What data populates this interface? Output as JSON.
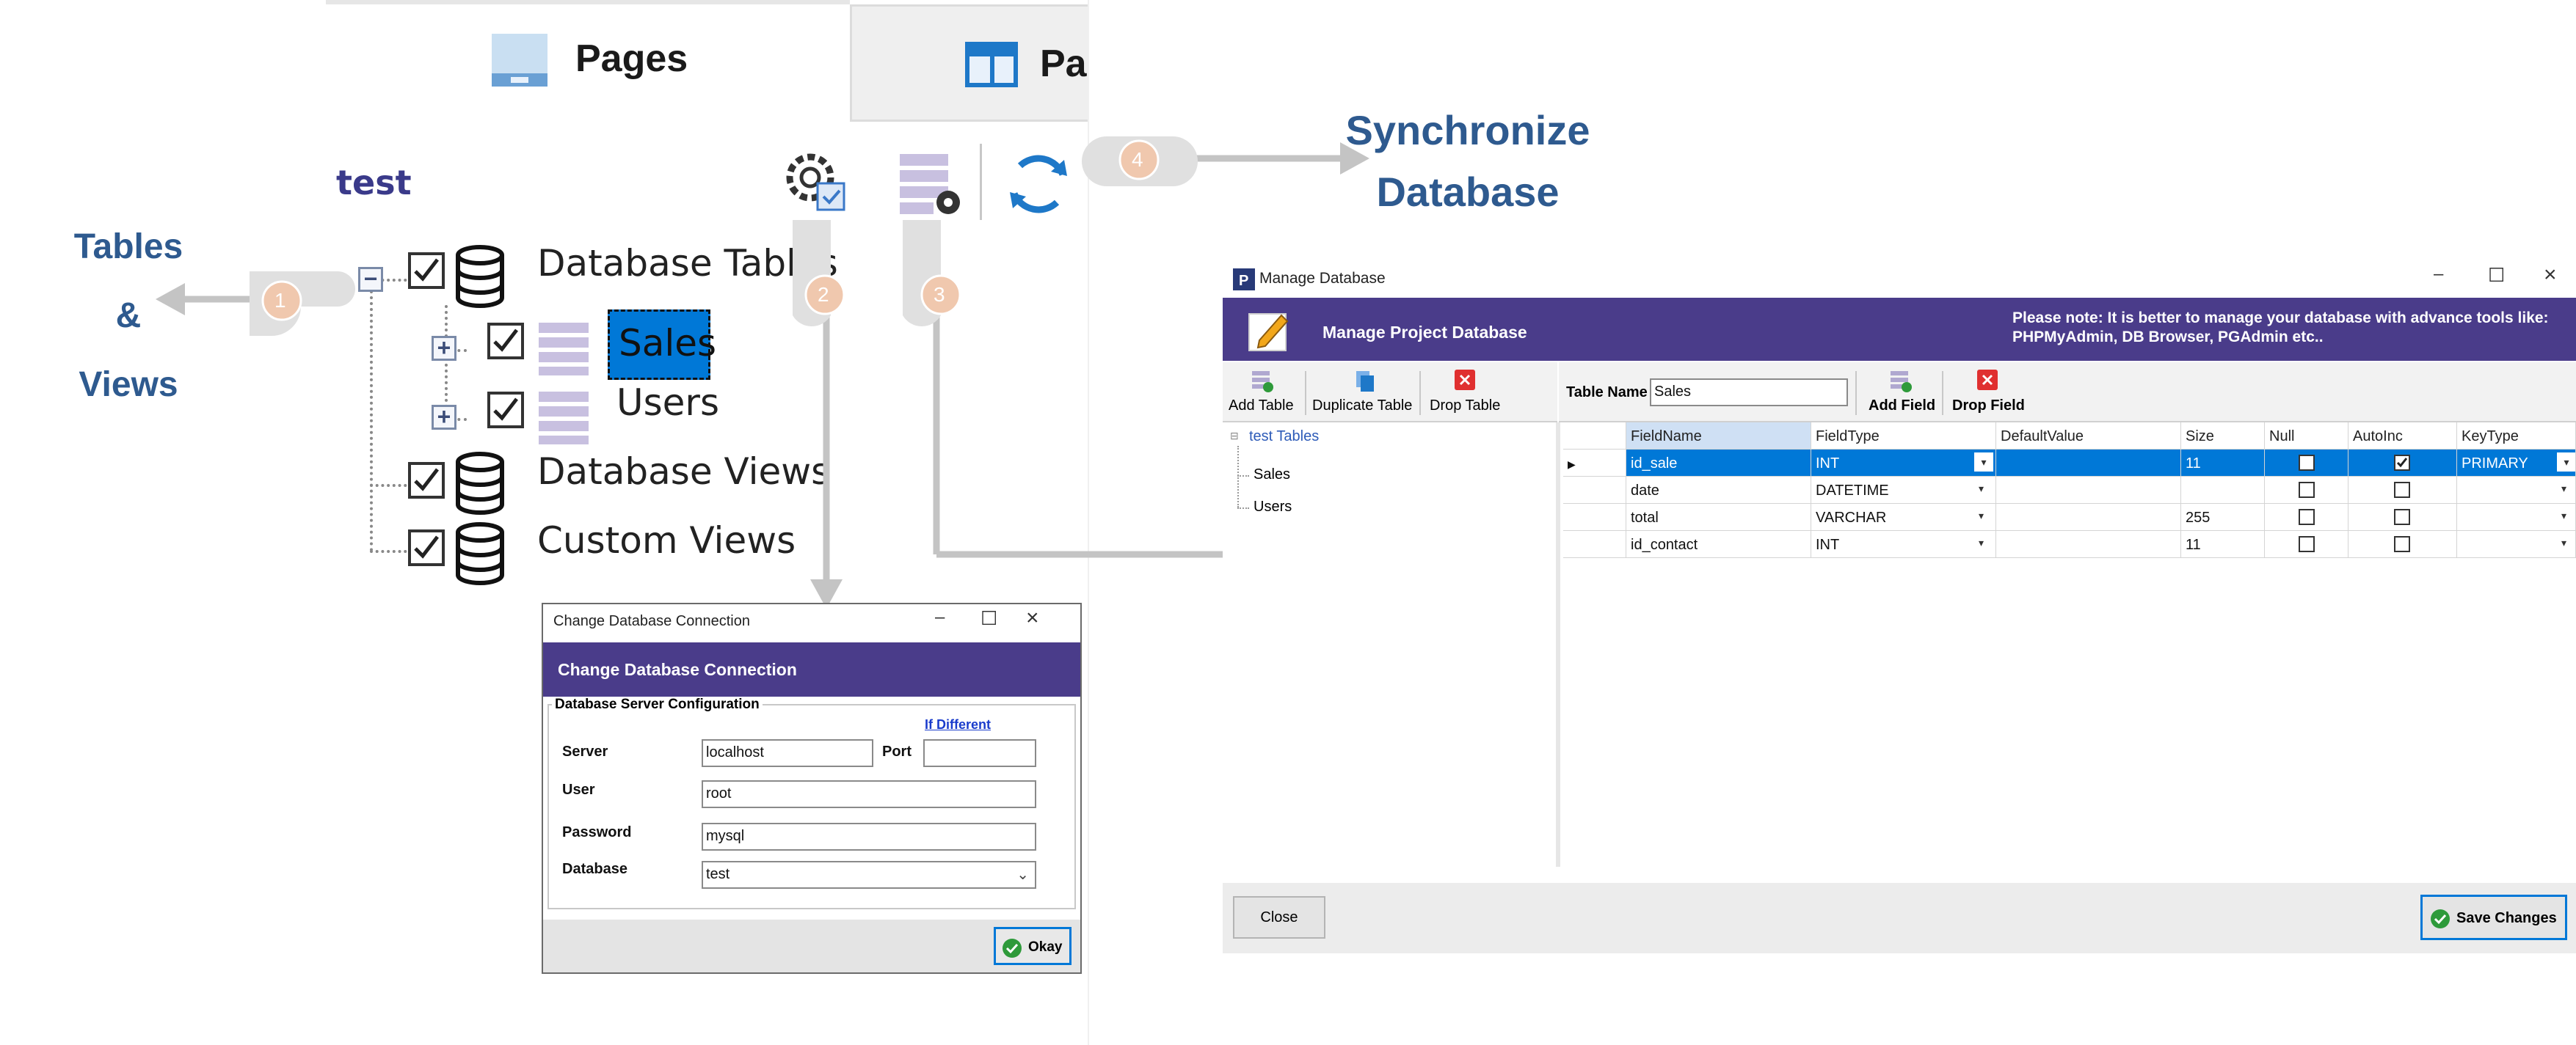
{
  "tabs": [
    {
      "label": "Pages",
      "icon": "page-icon"
    },
    {
      "label": "Pa",
      "icon": "layout-icon"
    }
  ],
  "project_name": "test",
  "callouts": {
    "tables_views": [
      "Tables",
      "&",
      "Views"
    ],
    "synchronize": [
      "Synchronize",
      "Database"
    ],
    "steps": [
      "1",
      "2",
      "3",
      "4"
    ]
  },
  "tree": {
    "database_tables": "Database Tables",
    "sales": "Sales",
    "users": "Users",
    "database_views": "Database Views",
    "custom_views": "Custom Views"
  },
  "conn_dialog": {
    "title": "Change Database Connection",
    "header": "Change Database Connection",
    "group": "Database Server Configuration",
    "if_different": "If Different",
    "server_label": "Server",
    "server_value": "localhost",
    "port_label": "Port",
    "port_value": "",
    "user_label": "User",
    "user_value": "root",
    "password_label": "Password",
    "password_value": "mysql",
    "database_label": "Database",
    "database_value": "test",
    "okay": "Okay"
  },
  "manage_dialog": {
    "title": "Manage Database",
    "header": "Manage Project Database",
    "note_line1": "Please note: It is better to manage your database with advance tools like:",
    "note_line2": "PHPMyAdmin, DB Browser, PGAdmin etc..",
    "add_table": "Add Table",
    "duplicate_table": "Duplicate Table",
    "drop_table": "Drop Table",
    "table_name_label": "Table Name",
    "table_name_value": "Sales",
    "add_field": "Add Field",
    "drop_field": "Drop Field",
    "tree_root": "test Tables",
    "tree_items": [
      "Sales",
      "Users"
    ],
    "columns": [
      "FieldName",
      "FieldType",
      "DefaultValue",
      "Size",
      "Null",
      "AutoInc",
      "KeyType"
    ],
    "rows": [
      {
        "name": "id_sale",
        "type": "INT",
        "default": "",
        "size": "11",
        "null": false,
        "autoinc": true,
        "key": "PRIMARY"
      },
      {
        "name": "date",
        "type": "DATETIME",
        "default": "",
        "size": "",
        "null": false,
        "autoinc": false,
        "key": ""
      },
      {
        "name": "total",
        "type": "VARCHAR",
        "default": "",
        "size": "255",
        "null": false,
        "autoinc": false,
        "key": ""
      },
      {
        "name": "id_contact",
        "type": "INT",
        "default": "",
        "size": "11",
        "null": false,
        "autoinc": false,
        "key": ""
      }
    ],
    "close": "Close",
    "save": "Save Changes"
  },
  "colors": {
    "purple": "#4a3c8a",
    "callout_text": "#2e5a8f",
    "step_circle": "#f0c8ae",
    "selection": "#0078d7",
    "arrow": "#c0c0c0"
  }
}
